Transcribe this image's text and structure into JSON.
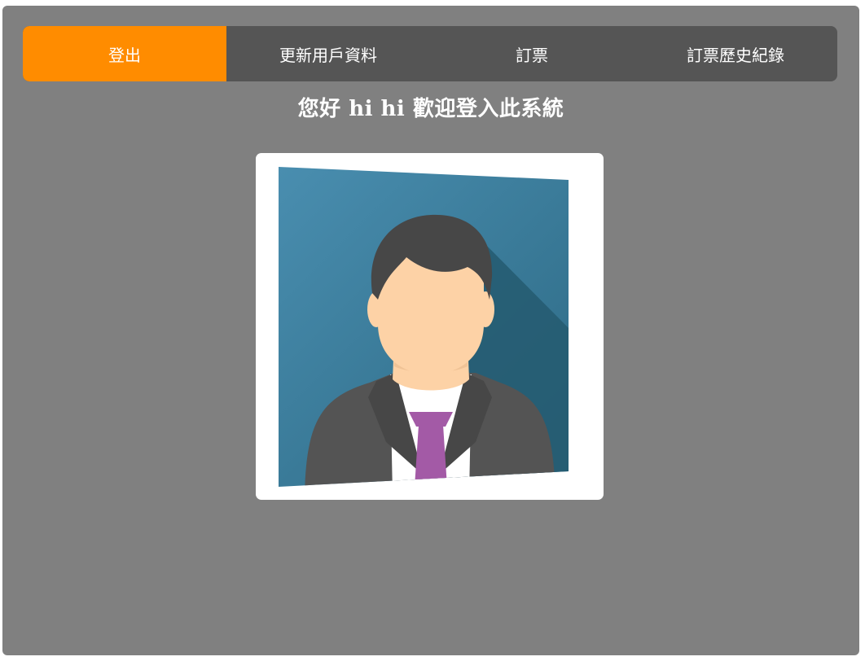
{
  "nav": {
    "items": [
      {
        "label": "登出",
        "active": true
      },
      {
        "label": "更新用戶資料",
        "active": false
      },
      {
        "label": "訂票",
        "active": false
      },
      {
        "label": "訂票歷史紀錄",
        "active": false
      }
    ]
  },
  "welcome": {
    "text": "您好 hi hi 歡迎登入此系統"
  },
  "avatar": {
    "icon": "businessman-avatar-icon"
  },
  "colors": {
    "panel_bg": "#808080",
    "nav_bg": "#555555",
    "nav_active": "#ff8c00",
    "text": "#ffffff",
    "avatar_bg_light": "#4a8fb0",
    "avatar_bg_dark": "#245a70",
    "tie": "#a35aa6",
    "skin": "#fdd2a6",
    "hair": "#474747",
    "suit": "#555555"
  }
}
